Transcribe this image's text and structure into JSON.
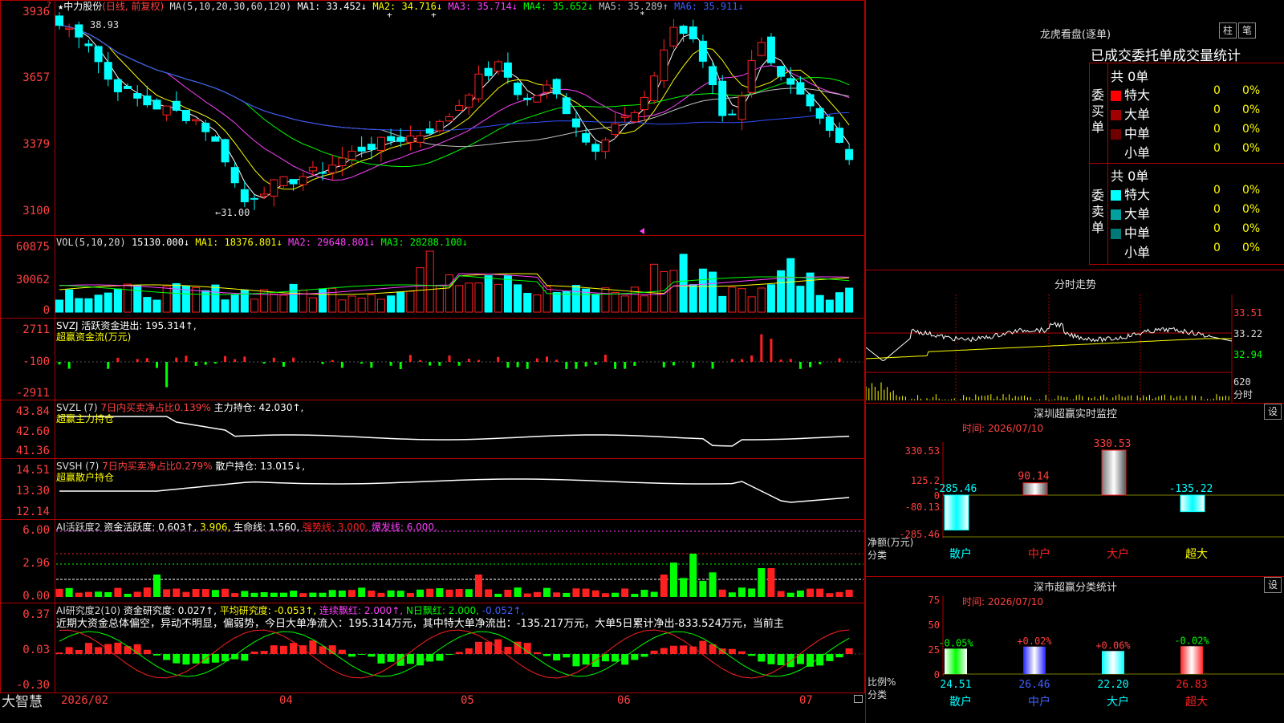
{
  "app": {
    "logo": "大智慧"
  },
  "main": {
    "name": "中力股份",
    "adjust": "(日线, 前复权)",
    "ma_title": "MA(5,10,20,30,60,120)",
    "ma": [
      {
        "label": "MA1: 33.452↓",
        "color": "#ffffff"
      },
      {
        "label": "MA2: 34.716↓",
        "color": "#ffff00"
      },
      {
        "label": "MA3: 35.714↓",
        "color": "#ff40ff"
      },
      {
        "label": "MA4: 35.652↓",
        "color": "#00ff00"
      },
      {
        "label": "MA5: 35.289↑",
        "color": "#c0c0c0"
      },
      {
        "label": "MA6: 35.911↓",
        "color": "#4040ff"
      }
    ],
    "y_ticks": [
      "3936",
      "3657",
      "3379",
      "3100"
    ],
    "high_label": "38.93",
    "low_label": "31.00"
  },
  "vol": {
    "title": "VOL(5,10,20)",
    "value": "15130.000↓",
    "ma1": "MA1: 18376.801↓",
    "ma2": "MA2: 29648.801↓",
    "ma3": "MA3: 28288.100↓",
    "y_ticks": [
      "60875",
      "30062",
      "0"
    ]
  },
  "svzj": {
    "title": "SVZJ  活跃资金进出: 195.314↑,",
    "sub": "超赢资金流(万元)",
    "y_ticks": [
      "2711",
      "-100",
      "-2911"
    ]
  },
  "svzl": {
    "title": "SVZL (7)",
    "pct": "7日内买卖净占比0.139%",
    "hold": "主力持仓: 42.030↑,",
    "sub": "超赢主力持仓",
    "y_ticks": [
      "43.84",
      "42.60",
      "41.36"
    ]
  },
  "svsh": {
    "title": "SVSH (7)",
    "pct": "7日内买卖净占比0.279%",
    "hold": "散户持仓: 13.015↓,",
    "sub": "超赢散户持仓",
    "y_ticks": [
      "14.51",
      "13.30",
      "12.14"
    ]
  },
  "ai2": {
    "title": "AI活跃度2",
    "a": "资金活跃度: 0.603↑,",
    "b": "3.906,",
    "c": "生命线: 1.560,",
    "d": "强势线: 3.000,",
    "e": "爆发线: 6.000,",
    "y_ticks": [
      "6.00",
      "2.96",
      "0.00"
    ]
  },
  "ai_res": {
    "title": "AI研究度2(10)",
    "a": "资金研究度: 0.027↑,",
    "b": "平均研究度: -0.053↑,",
    "c": "连续飘红: 2.000↑,",
    "d": "N日飘红: 2.000,",
    "e": "-0.052↑,",
    "comment": "近期大资金总体偏空，异动不明显，偏弱势，今日大单净流入：195.314万元，其中特大单净流出：-135.217万元，大单5日累计净出-833.524万元，当前主",
    "y_ticks": [
      "0.37",
      "0.03",
      "-0.30"
    ]
  },
  "x_axis": [
    "2026/02",
    "04",
    "05",
    "06",
    "07"
  ],
  "dragon": {
    "title": "龙虎看盘(逐单)",
    "btn_zhu": "柱",
    "btn_bi": "笔",
    "header": "已成交委托单成交量统计",
    "buy_label": "委买单",
    "sell_label": "委卖单",
    "buy_total": "共 0单",
    "sell_total": "共 0单",
    "buy_rows": [
      {
        "name": "特大",
        "count": "0",
        "pct": "0%",
        "color": "#ff0000"
      },
      {
        "name": "大单",
        "count": "0",
        "pct": "0%",
        "color": "#a00000"
      },
      {
        "name": "中单",
        "count": "0",
        "pct": "0%",
        "color": "#700000"
      },
      {
        "name": "小单",
        "count": "0",
        "pct": "0%",
        "color": "#000000"
      }
    ],
    "sell_rows": [
      {
        "name": "特大",
        "count": "0",
        "pct": "0%",
        "color": "#00ffff"
      },
      {
        "name": "大单",
        "count": "0",
        "pct": "0%",
        "color": "#00a0a0"
      },
      {
        "name": "中单",
        "count": "0",
        "pct": "0%",
        "color": "#007878"
      },
      {
        "name": "小单",
        "count": "0",
        "pct": "0%",
        "color": "#000000"
      }
    ]
  },
  "intraday": {
    "title": "分时走势",
    "y_ticks": [
      "33.51",
      "33.22",
      "32.94"
    ],
    "vol_tick": "620",
    "vol_label": "分时"
  },
  "monitor": {
    "title": "深圳超赢实时监控",
    "btn": "设",
    "time": "时间: 2026/07/10",
    "y_ticks": [
      "330.53",
      "125.2",
      "0",
      "-80.13",
      "-285.46"
    ],
    "axis_label": "净额(万元)",
    "class_label": "分类",
    "bars": [
      {
        "name": "散户",
        "value": "-285.46"
      },
      {
        "name": "中户",
        "value": "90.14"
      },
      {
        "name": "大户",
        "value": "330.53"
      },
      {
        "name": "超大",
        "value": "-135.22"
      }
    ]
  },
  "stats": {
    "title": "深市超赢分类统计",
    "btn": "设",
    "time": "时间: 2026/07/10",
    "y_ticks": [
      "75",
      "50",
      "25",
      "0"
    ],
    "axis_label": "比例%",
    "class_label": "分类",
    "bars": [
      {
        "name": "散户",
        "pct": "24.51",
        "chg": "-0.05%"
      },
      {
        "name": "中户",
        "pct": "26.46",
        "chg": "+0.02%"
      },
      {
        "name": "大户",
        "pct": "22.20",
        "chg": "+0.06%"
      },
      {
        "name": "超大",
        "pct": "26.83",
        "chg": "-0.02%"
      }
    ]
  }
}
